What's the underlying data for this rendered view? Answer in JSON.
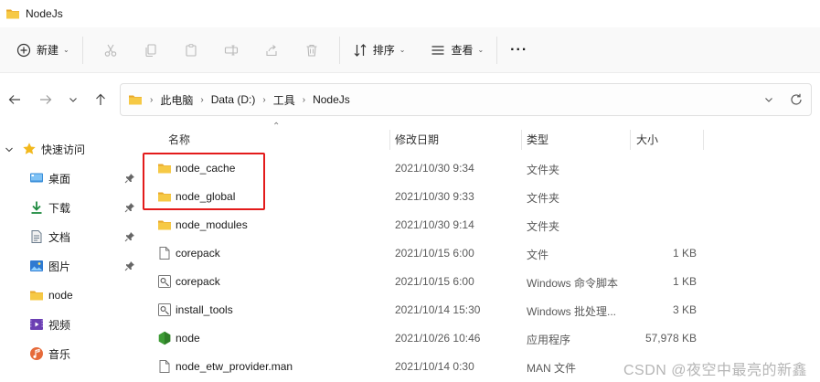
{
  "window": {
    "title": "NodeJs",
    "icon": "folder-icon"
  },
  "toolbar": {
    "new_label": "新建",
    "sort_label": "排序",
    "view_label": "查看",
    "more_label": "···"
  },
  "nav": {
    "breadcrumbs": [
      "此电脑",
      "Data (D:)",
      "工具",
      "NodeJs"
    ]
  },
  "sidebar": {
    "quick_access": "快速访问",
    "items": [
      {
        "label": "桌面",
        "icon": "desktop-icon",
        "pinned": true
      },
      {
        "label": "下载",
        "icon": "download-icon",
        "pinned": true
      },
      {
        "label": "文档",
        "icon": "document-icon",
        "pinned": true
      },
      {
        "label": "图片",
        "icon": "pictures-icon",
        "pinned": true
      },
      {
        "label": "node",
        "icon": "folder-icon",
        "pinned": false
      },
      {
        "label": "视频",
        "icon": "video-icon",
        "pinned": false
      },
      {
        "label": "音乐",
        "icon": "music-icon",
        "pinned": false
      }
    ]
  },
  "columns": {
    "name": "名称",
    "modified": "修改日期",
    "type": "类型",
    "size": "大小"
  },
  "files": [
    {
      "name": "node_cache",
      "modified": "2021/10/30 9:34",
      "type": "文件夹",
      "size": "",
      "icon": "folder-icon"
    },
    {
      "name": "node_global",
      "modified": "2021/10/30 9:33",
      "type": "文件夹",
      "size": "",
      "icon": "folder-icon"
    },
    {
      "name": "node_modules",
      "modified": "2021/10/30 9:14",
      "type": "文件夹",
      "size": "",
      "icon": "folder-icon"
    },
    {
      "name": "corepack",
      "modified": "2021/10/15 6:00",
      "type": "文件",
      "size": "1 KB",
      "icon": "file-icon"
    },
    {
      "name": "corepack",
      "modified": "2021/10/15 6:00",
      "type": "Windows 命令脚本",
      "size": "1 KB",
      "icon": "script-icon"
    },
    {
      "name": "install_tools",
      "modified": "2021/10/14 15:30",
      "type": "Windows 批处理...",
      "size": "3 KB",
      "icon": "script-icon"
    },
    {
      "name": "node",
      "modified": "2021/10/26 10:46",
      "type": "应用程序",
      "size": "57,978 KB",
      "icon": "nodejs-icon"
    },
    {
      "name": "node_etw_provider.man",
      "modified": "2021/10/14 0:30",
      "type": "MAN 文件",
      "size": "",
      "icon": "file-icon"
    }
  ],
  "watermark": "CSDN @夜空中最亮的新鑫",
  "colors": {
    "folder": "#f4c542",
    "highlight": "#e31b1b",
    "nodejs": "#3d9b35",
    "accent": "#0067c0"
  }
}
